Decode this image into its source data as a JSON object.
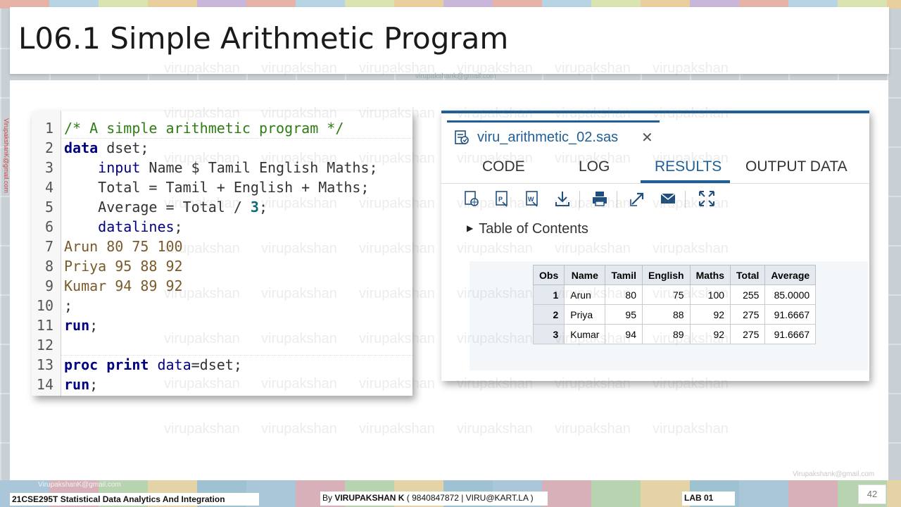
{
  "slide": {
    "title": "L06.1  Simple Arithmetic Program",
    "top_email": "virupakshank@gmail.com",
    "side_email": "VirupakshanK@gmail.com",
    "watermark": "virupakshan"
  },
  "code": {
    "lines": [
      {
        "n": "1",
        "parts": [
          {
            "t": "/* A simple arithmetic program */",
            "c": "c-comment"
          }
        ]
      },
      {
        "n": "2",
        "parts": [
          {
            "t": "data",
            "c": "c-kw"
          },
          {
            "t": " dset;",
            "c": "c-id"
          }
        ]
      },
      {
        "n": "3",
        "parts": [
          {
            "t": "    input",
            "c": "c-proc"
          },
          {
            "t": " Name $ Tamil English Maths;",
            "c": "c-id"
          }
        ]
      },
      {
        "n": "4",
        "parts": [
          {
            "t": "    Total = Tamil + English + Maths;",
            "c": "c-id"
          }
        ]
      },
      {
        "n": "5",
        "parts": [
          {
            "t": "    Average = Total / ",
            "c": "c-id"
          },
          {
            "t": "3",
            "c": "c-num"
          },
          {
            "t": ";",
            "c": "c-id"
          }
        ]
      },
      {
        "n": "6",
        "parts": [
          {
            "t": "    datalines",
            "c": "c-proc"
          },
          {
            "t": ";",
            "c": "c-id"
          }
        ]
      },
      {
        "n": "7",
        "parts": [
          {
            "t": "Arun 80 75 100",
            "c": "c-data"
          }
        ]
      },
      {
        "n": "8",
        "parts": [
          {
            "t": "Priya 95 88 92",
            "c": "c-data"
          }
        ]
      },
      {
        "n": "9",
        "parts": [
          {
            "t": "Kumar 94 89 92",
            "c": "c-data"
          }
        ]
      },
      {
        "n": "10",
        "parts": [
          {
            "t": ";",
            "c": "c-id"
          }
        ]
      },
      {
        "n": "11",
        "parts": [
          {
            "t": "run",
            "c": "c-kw"
          },
          {
            "t": ";",
            "c": "c-id"
          }
        ]
      },
      {
        "n": "12",
        "parts": [
          {
            "t": "",
            "c": "c-id"
          }
        ]
      },
      {
        "n": "13",
        "parts": [
          {
            "t": "proc print",
            "c": "c-kw"
          },
          {
            "t": " ",
            "c": "c-id"
          },
          {
            "t": "data",
            "c": "c-proc"
          },
          {
            "t": "=dset;",
            "c": "c-id"
          }
        ]
      },
      {
        "n": "14",
        "parts": [
          {
            "t": "run",
            "c": "c-kw"
          },
          {
            "t": ";",
            "c": "c-id"
          }
        ]
      }
    ]
  },
  "sas": {
    "file_tab": "viru_arithmetic_02.sas",
    "close_glyph": "✕",
    "subtabs": [
      "CODE",
      "LOG",
      "RESULTS",
      "OUTPUT DATA"
    ],
    "active_subtab": "RESULTS",
    "toolbar_icons": [
      "html-output-icon",
      "pdf-output-icon",
      "rtf-output-icon",
      "download-icon",
      "print-icon",
      "open-new-window-icon",
      "email-icon",
      "maximize-icon"
    ],
    "toc_label": "Table of Contents",
    "table": {
      "headers": [
        "Obs",
        "Name",
        "Tamil",
        "English",
        "Maths",
        "Total",
        "Average"
      ],
      "rows": [
        [
          "1",
          "Arun",
          "80",
          "75",
          "100",
          "255",
          "85.0000"
        ],
        [
          "2",
          "Priya",
          "95",
          "88",
          "92",
          "275",
          "91.6667"
        ],
        [
          "3",
          "Kumar",
          "94",
          "89",
          "92",
          "275",
          "91.6667"
        ]
      ]
    },
    "accent_color": "#1f5f97"
  },
  "footer": {
    "email_left": "VirupakshanK@gmail.com",
    "email_right": "Virupakshank@gmail.com",
    "course": "21CSE295T Statistical Data Analytics And Integration",
    "author_prefix": "By ",
    "author_name": "VIRUPAKSHAN K",
    "author_suffix": " ( 9840847872 | VIRU@KART.LA )",
    "lab": "LAB  01",
    "page": "42"
  }
}
